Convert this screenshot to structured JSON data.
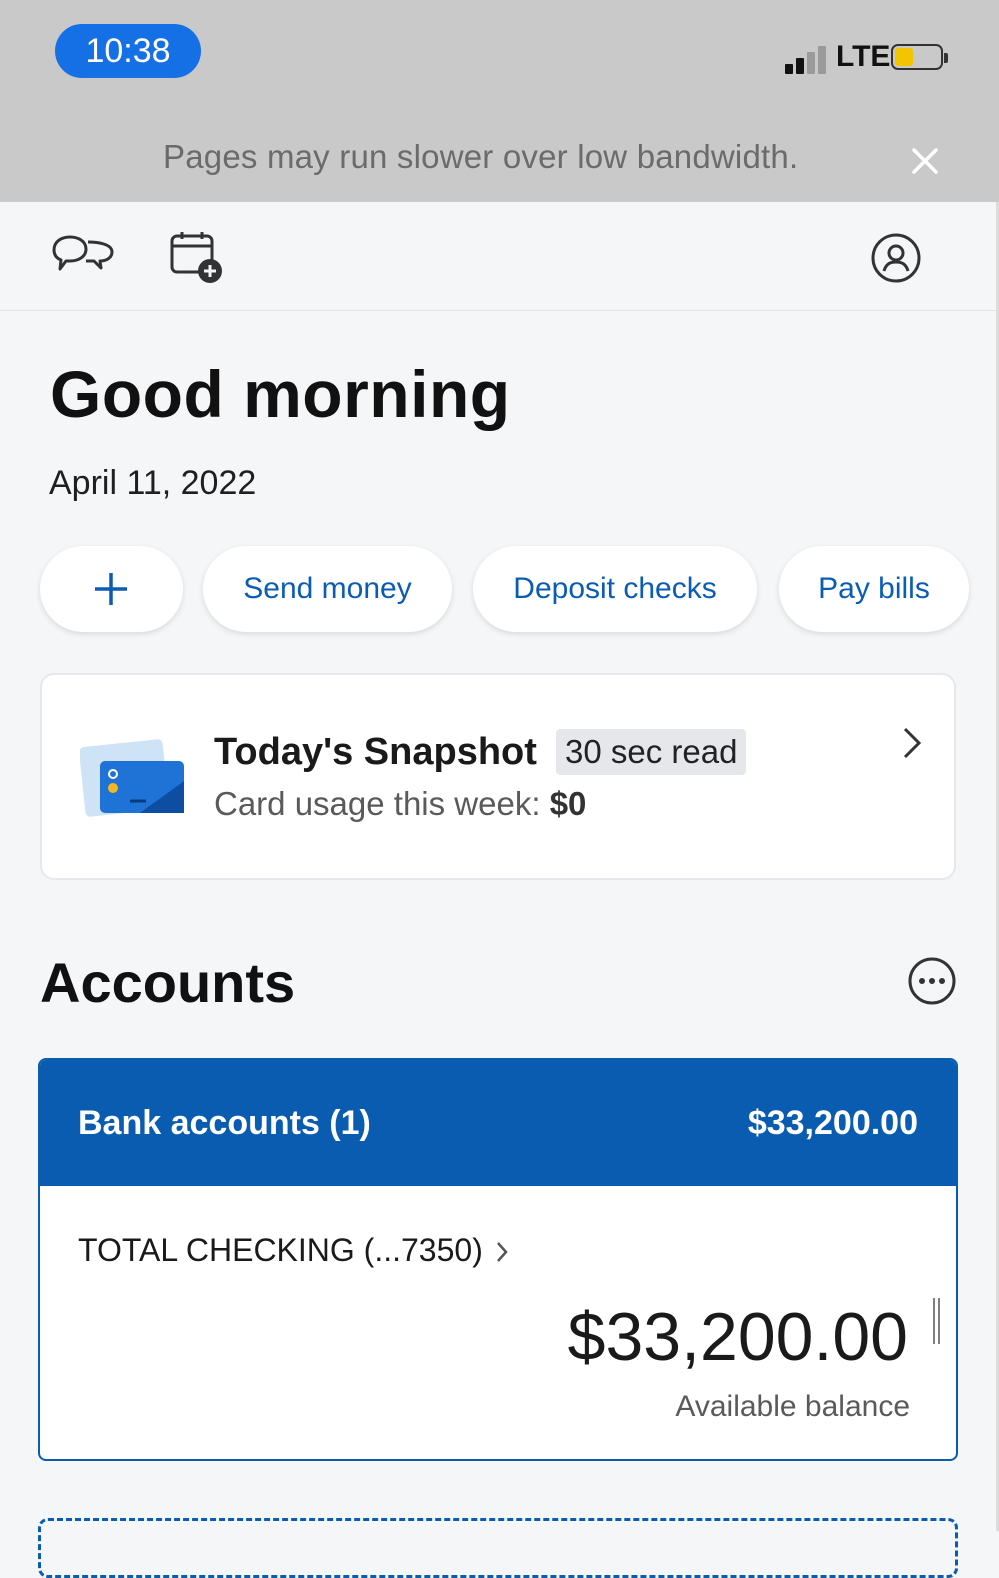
{
  "status_bar": {
    "time": "10:38",
    "network": "LTE",
    "signal_bars_filled": 2,
    "battery_color": "#f2c500"
  },
  "banner": {
    "message": "Pages may run slower over low bandwidth.",
    "close_icon": "close-icon"
  },
  "topnav": {
    "left_icons": [
      "chat-icon",
      "calendar-add-icon"
    ],
    "right_icon": "profile-icon"
  },
  "greeting": {
    "title": "Good morning",
    "date": "April 11, 2022"
  },
  "quick_actions": {
    "add_icon": "plus-icon",
    "send_money": "Send money",
    "deposit_checks": "Deposit checks",
    "pay_bills": "Pay bills"
  },
  "snapshot": {
    "title": "Today's Snapshot",
    "badge": "30 sec read",
    "subtitle_prefix": "Card usage this week:",
    "subtitle_value": "$0",
    "icon": "card-icon"
  },
  "accounts": {
    "title": "Accounts",
    "more_icon": "more-options-icon",
    "group_label": "Bank accounts (1)",
    "group_total": "$33,200.00",
    "account_name": "TOTAL CHECKING (...7350)",
    "balance": "$33,200.00",
    "balance_label": "Available balance"
  },
  "colors": {
    "brand_blue": "#0a5cb1",
    "link_blue": "#0b5cb5",
    "status_pill": "#1570e6"
  }
}
